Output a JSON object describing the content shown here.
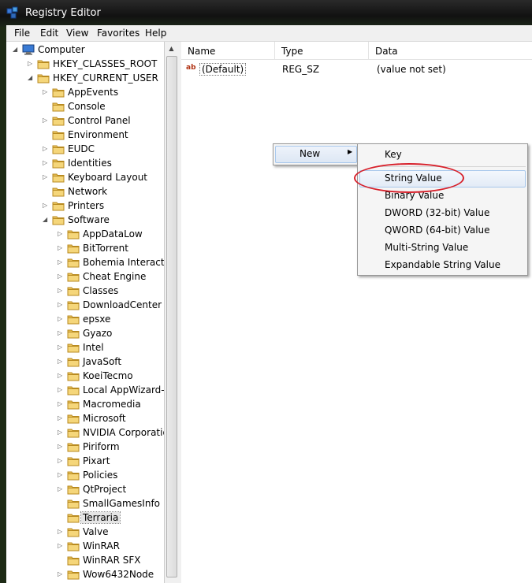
{
  "window": {
    "title": "Registry Editor"
  },
  "menubar": [
    "File",
    "Edit",
    "View",
    "Favorites",
    "Help"
  ],
  "tree": {
    "nodes": [
      {
        "label": "Computer",
        "icon": "computer-icon",
        "twisty": "expanded"
      },
      {
        "label": "HKEY_CLASSES_ROOT",
        "icon": "folder-icon",
        "twisty": "collapsed"
      },
      {
        "label": "HKEY_CURRENT_USER",
        "icon": "folder-icon",
        "twisty": "expanded"
      },
      {
        "label": "AppEvents",
        "icon": "folder-icon",
        "twisty": "collapsed"
      },
      {
        "label": "Console",
        "icon": "folder-icon",
        "twisty": "none"
      },
      {
        "label": "Control Panel",
        "icon": "folder-icon",
        "twisty": "collapsed"
      },
      {
        "label": "Environment",
        "icon": "folder-icon",
        "twisty": "none"
      },
      {
        "label": "EUDC",
        "icon": "folder-icon",
        "twisty": "collapsed"
      },
      {
        "label": "Identities",
        "icon": "folder-icon",
        "twisty": "collapsed"
      },
      {
        "label": "Keyboard Layout",
        "icon": "folder-icon",
        "twisty": "collapsed"
      },
      {
        "label": "Network",
        "icon": "folder-icon",
        "twisty": "none"
      },
      {
        "label": "Printers",
        "icon": "folder-icon",
        "twisty": "collapsed"
      },
      {
        "label": "Software",
        "icon": "folder-icon",
        "twisty": "expanded"
      },
      {
        "label": "AppDataLow",
        "icon": "folder-icon",
        "twisty": "collapsed"
      },
      {
        "label": "BitTorrent",
        "icon": "folder-icon",
        "twisty": "collapsed"
      },
      {
        "label": "Bohemia Interactiv",
        "icon": "folder-icon",
        "twisty": "collapsed"
      },
      {
        "label": "Cheat Engine",
        "icon": "folder-icon",
        "twisty": "collapsed"
      },
      {
        "label": "Classes",
        "icon": "folder-icon",
        "twisty": "collapsed"
      },
      {
        "label": "DownloadCenter",
        "icon": "folder-icon",
        "twisty": "collapsed"
      },
      {
        "label": "epsxe",
        "icon": "folder-icon",
        "twisty": "collapsed"
      },
      {
        "label": "Gyazo",
        "icon": "folder-icon",
        "twisty": "collapsed"
      },
      {
        "label": "Intel",
        "icon": "folder-icon",
        "twisty": "collapsed"
      },
      {
        "label": "JavaSoft",
        "icon": "folder-icon",
        "twisty": "collapsed"
      },
      {
        "label": "KoeiTecmo",
        "icon": "folder-icon",
        "twisty": "collapsed"
      },
      {
        "label": "Local AppWizard-",
        "icon": "folder-icon",
        "twisty": "collapsed"
      },
      {
        "label": "Macromedia",
        "icon": "folder-icon",
        "twisty": "collapsed"
      },
      {
        "label": "Microsoft",
        "icon": "folder-icon",
        "twisty": "collapsed"
      },
      {
        "label": "NVIDIA Corporatio",
        "icon": "folder-icon",
        "twisty": "collapsed"
      },
      {
        "label": "Piriform",
        "icon": "folder-icon",
        "twisty": "collapsed"
      },
      {
        "label": "Pixart",
        "icon": "folder-icon",
        "twisty": "collapsed"
      },
      {
        "label": "Policies",
        "icon": "folder-icon",
        "twisty": "collapsed"
      },
      {
        "label": "QtProject",
        "icon": "folder-icon",
        "twisty": "collapsed"
      },
      {
        "label": "SmallGamesInfo",
        "icon": "folder-icon",
        "twisty": "none"
      },
      {
        "label": "Terraria",
        "icon": "folder-icon",
        "twisty": "none",
        "selected": true
      },
      {
        "label": "Valve",
        "icon": "folder-icon",
        "twisty": "collapsed"
      },
      {
        "label": "WinRAR",
        "icon": "folder-icon",
        "twisty": "collapsed"
      },
      {
        "label": "WinRAR SFX",
        "icon": "folder-icon",
        "twisty": "none"
      },
      {
        "label": "Wow6432Node",
        "icon": "folder-icon",
        "twisty": "collapsed"
      }
    ]
  },
  "list": {
    "columns": [
      "Name",
      "Type",
      "Data"
    ],
    "rows": [
      {
        "icon": "string-value-icon",
        "name": "(Default)",
        "type": "REG_SZ",
        "data": "(value not set)"
      }
    ]
  },
  "context_menu": {
    "items": [
      {
        "label": "New",
        "has_submenu": true
      }
    ]
  },
  "submenu": {
    "items": [
      {
        "label": "Key"
      },
      {
        "label": "String Value",
        "highlighted": true
      },
      {
        "label": "Binary Value"
      },
      {
        "label": "DWORD (32-bit) Value"
      },
      {
        "label": "QWORD (64-bit) Value"
      },
      {
        "label": "Multi-String Value"
      },
      {
        "label": "Expandable String Value"
      }
    ]
  },
  "annotation": {
    "color": "#d7202a"
  },
  "colors": {
    "folder": "#e8c15a",
    "highlight_border": "#a8c8ec"
  }
}
